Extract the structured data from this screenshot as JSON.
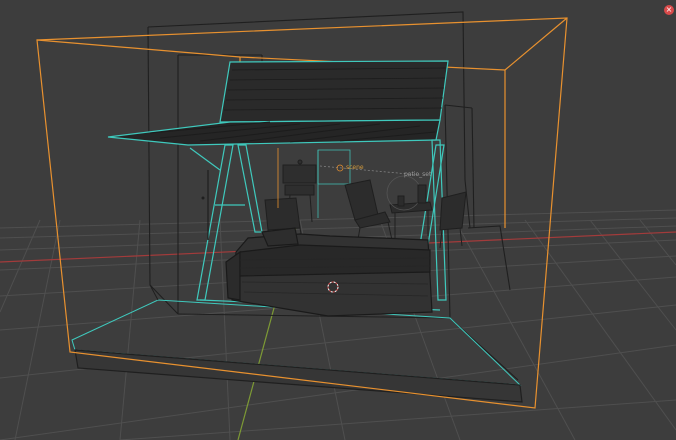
{
  "window": {
    "close_glyph": "×"
  },
  "viewport": {
    "background": "#3d3d3d",
    "grid_color": "#4f4f4f",
    "x_axis_color": "#a33b3b",
    "y_axis_color": "#7d9a35",
    "selection_color": "#e8912f",
    "wire_color": "#3fc9bd",
    "dark_wire_color": "#1f1f1f",
    "labels": {
      "scene": "scene",
      "object": "patio_set"
    }
  },
  "icons": [
    "close-icon",
    "3d-cursor-icon"
  ]
}
